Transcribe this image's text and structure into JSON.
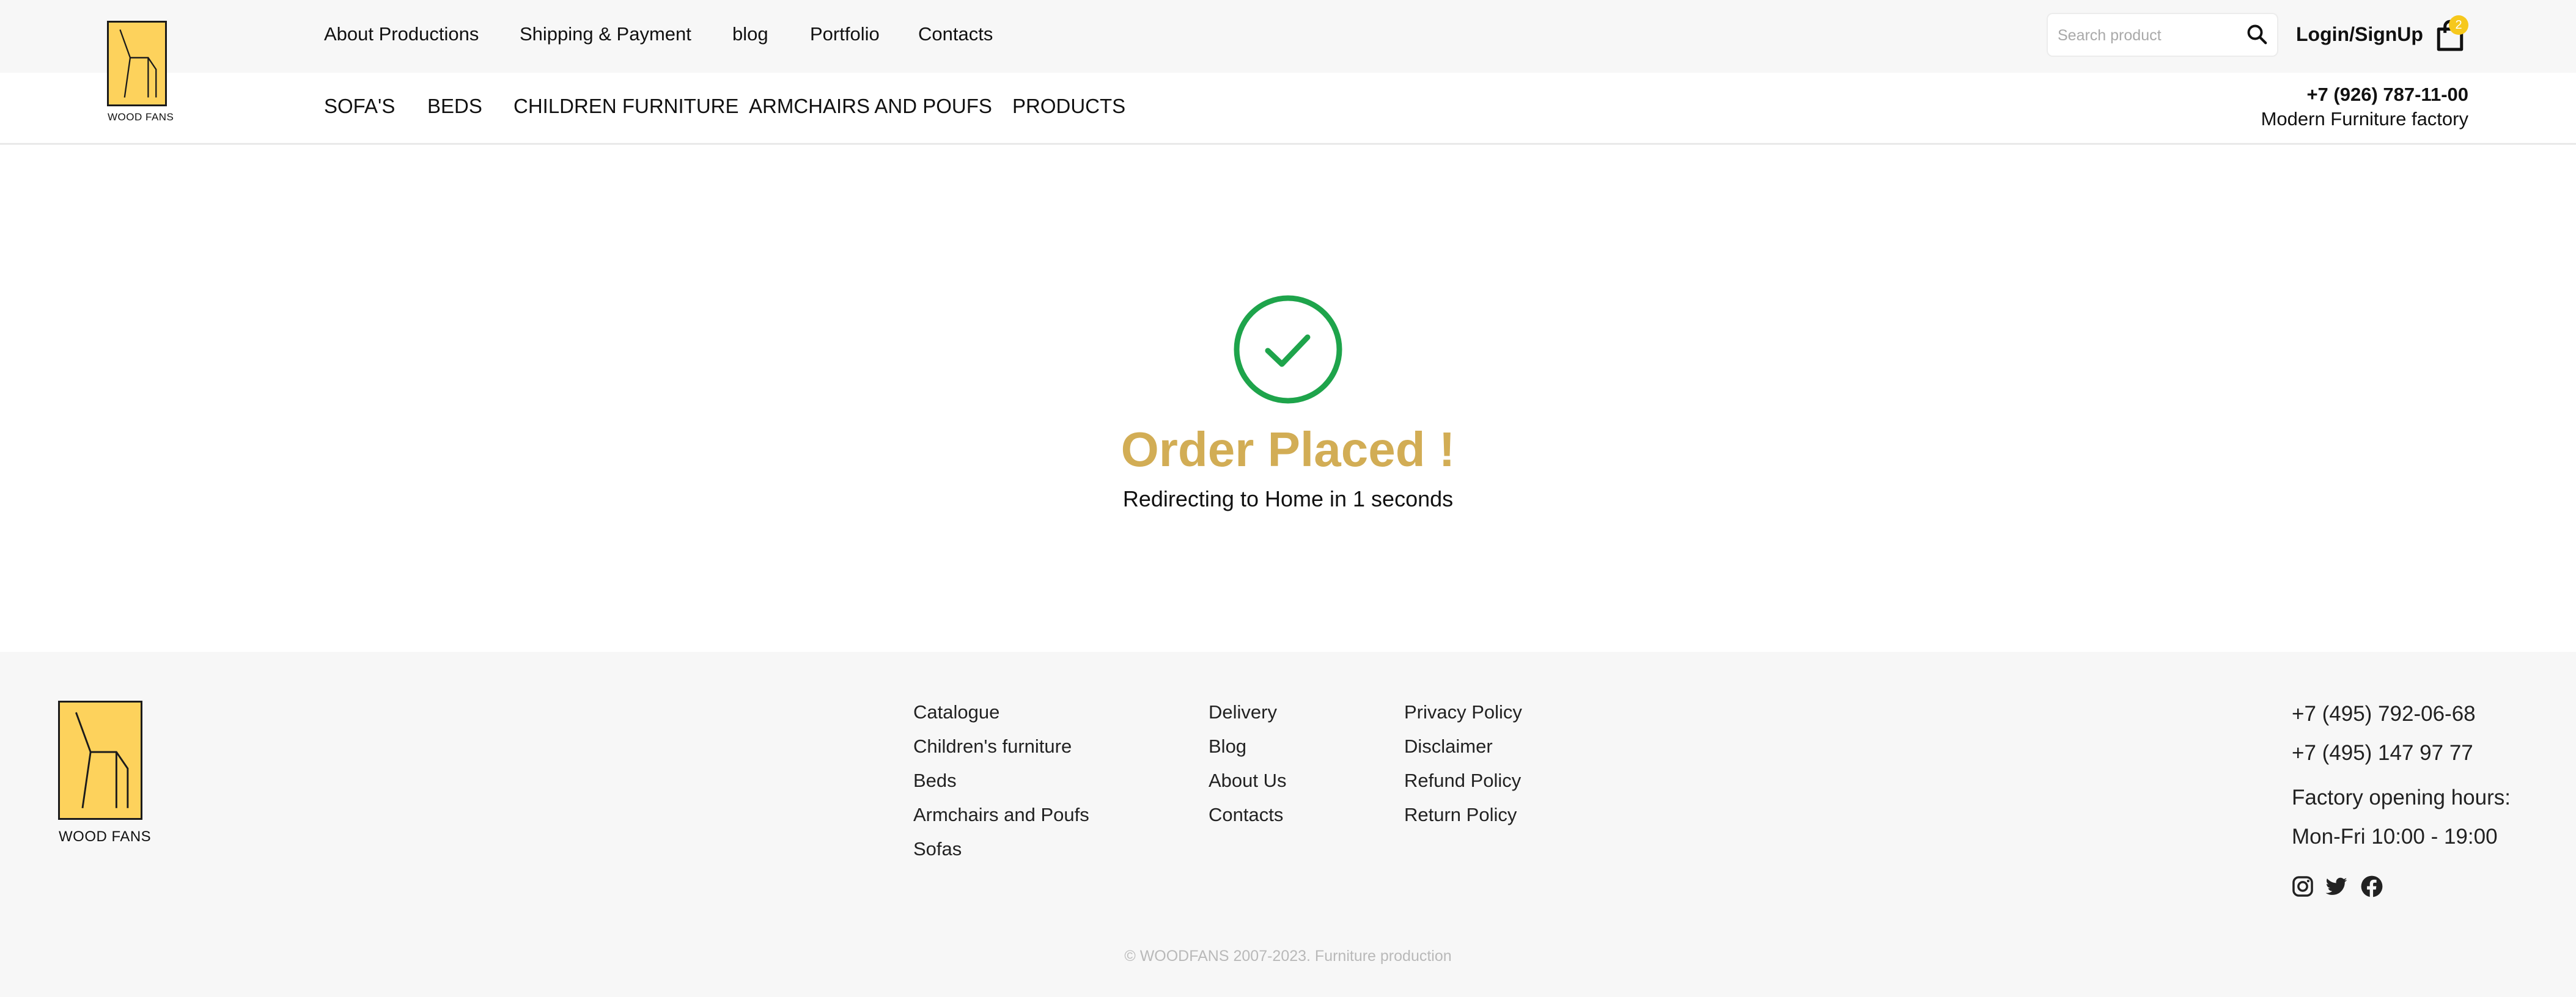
{
  "brand": {
    "name": "WOOD FANS",
    "accent_color": "#fdd25c",
    "logo_icon": "chair-logo-icon"
  },
  "header": {
    "top_links": [
      "About Productions",
      "Shipping & Payment",
      "blog",
      "Portfolio",
      "Contacts"
    ],
    "search": {
      "placeholder": "Search product",
      "icon": "search-icon"
    },
    "login_label": "Login/SignUp",
    "cart": {
      "icon": "shopping-bag-icon",
      "count": "2"
    },
    "phone": "+7 (926) 787-11-00",
    "tagline": "Modern Furniture factory"
  },
  "categories": [
    "SOFA'S",
    "BEDS",
    "CHILDREN FURNITURE",
    "ARMCHAIRS AND POUFS",
    "PRODUCTS"
  ],
  "confirmation": {
    "icon": "check-circle-icon",
    "title": "Order Placed !",
    "message": "Redirecting to Home in 1 seconds",
    "title_color": "#d2ad55",
    "success_color": "#1ea44b"
  },
  "footer": {
    "col1": [
      "Catalogue",
      "Children's furniture",
      "Beds",
      "Armchairs and Poufs",
      "Sofas"
    ],
    "col2": [
      "Delivery",
      "Blog",
      "About Us",
      "Contacts"
    ],
    "col3": [
      "Privacy Policy",
      "Disclaimer",
      "Refund Policy",
      "Return Policy"
    ],
    "phones": [
      "+7 (495) 792-06-68",
      "+7 (495) 147 97 77"
    ],
    "hours_label": "Factory opening hours:",
    "hours": "Mon-Fri 10:00 - 19:00",
    "social_icons": [
      "instagram-icon",
      "twitter-icon",
      "facebook-icon"
    ],
    "copyright": "© WOODFANS 2007-2023. Furniture production"
  }
}
